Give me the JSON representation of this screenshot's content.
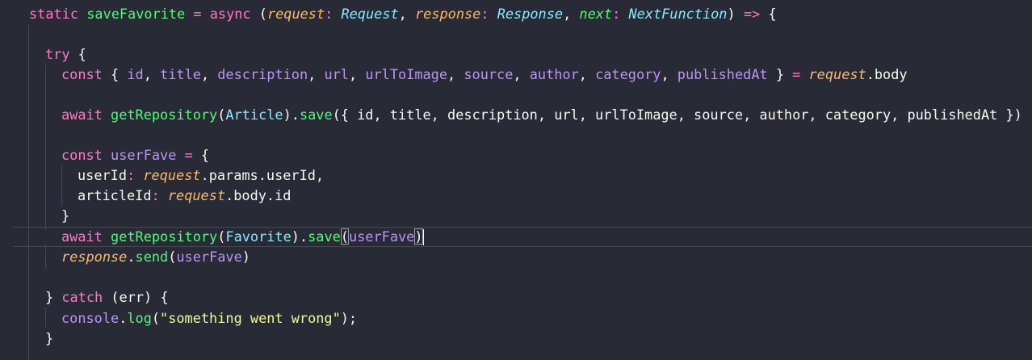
{
  "line01": {
    "static": "static",
    "method": "saveFavorite",
    "eq": " = ",
    "async": "async",
    "open": " (",
    "request": "request",
    "sep1": ": ",
    "Request": "Request",
    "comma1": ", ",
    "response": "response",
    "sep2": ": ",
    "Response": "Response",
    "comma2": ", ",
    "next": "next",
    "sep3": ": ",
    "NextFunction": "NextFunction",
    "close": ") ",
    "arrow": "=>",
    "brace": " {"
  },
  "line03": {
    "try": "try",
    "brace": " {"
  },
  "line04": {
    "const": "const",
    "open": " { ",
    "id": "id",
    "c1": ", ",
    "title": "title",
    "c2": ", ",
    "description": "description",
    "c3": ", ",
    "url": "url",
    "c4": ", ",
    "urlToImage": "urlToImage",
    "c5": ", ",
    "source": "source",
    "c6": ", ",
    "author": "author",
    "c7": ", ",
    "category": "category",
    "c8": ", ",
    "publishedAt": "publishedAt",
    "close": " } ",
    "eq": "=",
    "sp": " ",
    "request": "request",
    "body": ".body"
  },
  "line06": {
    "await": "await",
    "sp": " ",
    "getRepository": "getRepository",
    "p1": "(",
    "Article": "Article",
    "p2": ").",
    "save": "save",
    "args": "({ id, title, description, url, urlToImage, source, author, category, publishedAt })"
  },
  "line08": {
    "const": "const",
    "sp": " ",
    "userFave": "userFave",
    "eq": " = ",
    "brace": "{"
  },
  "line09": {
    "key": "userId",
    "colon": ": ",
    "request": "request",
    "rest": ".params.userId,"
  },
  "line10": {
    "key": "articleId",
    "colon": ": ",
    "request": "request",
    "rest": ".body.id"
  },
  "line11": {
    "brace": "}"
  },
  "line12": {
    "await": "await",
    "sp": " ",
    "getRepository": "getRepository",
    "p1": "(",
    "Favorite": "Favorite",
    "p2": ").",
    "save": "save",
    "lparen": "(",
    "userFave": "userFave",
    "rparen": ")"
  },
  "line13": {
    "response": "response",
    "dot": ".",
    "send": "send",
    "lparen": "(",
    "userFave": "userFave",
    "rparen": ")"
  },
  "line15": {
    "close": "} ",
    "catch": "catch",
    "args": " (err) {"
  },
  "line16": {
    "console": "console",
    "dot": ".",
    "log": "log",
    "lparen": "(",
    "str": "\"something went wrong\"",
    "rparen": ");"
  },
  "line17": {
    "brace": "}"
  }
}
